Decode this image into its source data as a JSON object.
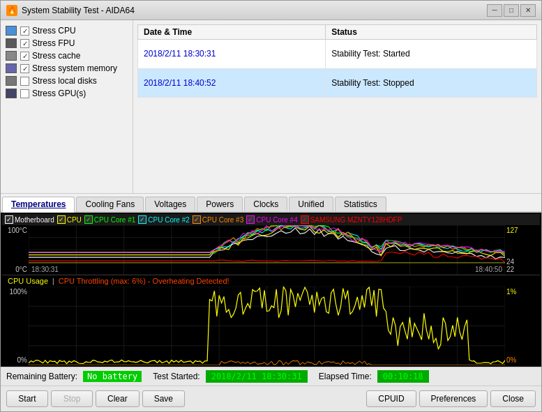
{
  "window": {
    "title": "System Stability Test - AIDA64",
    "icon": "🔥"
  },
  "titlebar": {
    "minimize_label": "─",
    "maximize_label": "□",
    "close_label": "✕"
  },
  "stress_items": [
    {
      "id": "cpu",
      "label": "Stress CPU",
      "checked": true,
      "icon_type": "cpu"
    },
    {
      "id": "fpu",
      "label": "Stress FPU",
      "checked": true,
      "icon_type": "fpu"
    },
    {
      "id": "cache",
      "label": "Stress cache",
      "checked": true,
      "icon_type": "cache"
    },
    {
      "id": "memory",
      "label": "Stress system memory",
      "checked": true,
      "icon_type": "mem"
    },
    {
      "id": "disks",
      "label": "Stress local disks",
      "checked": false,
      "icon_type": "disk"
    },
    {
      "id": "gpu",
      "label": "Stress GPU(s)",
      "checked": false,
      "icon_type": "gpu"
    }
  ],
  "log": {
    "headers": [
      "Date & Time",
      "Status"
    ],
    "rows": [
      {
        "datetime": "2018/2/11 18:30:31",
        "status": "Stability Test: Started",
        "selected": false
      },
      {
        "datetime": "2018/2/11 18:40:52",
        "status": "Stability Test: Stopped",
        "selected": true
      }
    ]
  },
  "tabs": [
    {
      "id": "temperatures",
      "label": "Temperatures",
      "active": true
    },
    {
      "id": "cooling_fans",
      "label": "Cooling Fans",
      "active": false
    },
    {
      "id": "voltages",
      "label": "Voltages",
      "active": false
    },
    {
      "id": "powers",
      "label": "Powers",
      "active": false
    },
    {
      "id": "clocks",
      "label": "Clocks",
      "active": false
    },
    {
      "id": "unified",
      "label": "Unified",
      "active": false
    },
    {
      "id": "statistics",
      "label": "Statistics",
      "active": false
    }
  ],
  "temp_chart": {
    "legend": [
      {
        "label": "Motherboard",
        "color": "#ffffff",
        "checked": true
      },
      {
        "label": "CPU",
        "color": "#ffff00",
        "checked": true
      },
      {
        "label": "CPU Core #1",
        "color": "#00ff00",
        "checked": true
      },
      {
        "label": "CPU Core #2",
        "color": "#00ffff",
        "checked": true
      },
      {
        "label": "CPU Core #3",
        "color": "#ff8800",
        "checked": true
      },
      {
        "label": "CPU Core #4",
        "color": "#ff00ff",
        "checked": true
      },
      {
        "label": "SAMSUNG MZNTY128HDFP",
        "color": "#ff0000",
        "checked": true
      }
    ],
    "y_max": "100°C",
    "y_min": "0°C",
    "right_values": [
      "127",
      "24",
      "22"
    ],
    "x_labels": [
      "18:30:31",
      "18:40:50"
    ],
    "time_start": "18:30:31",
    "time_end": "18:40:50"
  },
  "cpu_chart": {
    "label_usage": "CPU Usage",
    "label_throttling": "CPU Throttling (max: 6%) - Overheating Detected!",
    "y_max": "100%",
    "y_min": "0%",
    "right_values": [
      "1%",
      "0%"
    ]
  },
  "status_bar": {
    "battery_label": "Remaining Battery:",
    "battery_value": "No battery",
    "test_started_label": "Test Started:",
    "test_started_value": "2018/2/11 18:30:31",
    "elapsed_label": "Elapsed Time:",
    "elapsed_value": "00:10:18"
  },
  "buttons": {
    "start": "Start",
    "stop": "Stop",
    "clear": "Clear",
    "save": "Save",
    "cpuid": "CPUID",
    "preferences": "Preferences",
    "close": "Close"
  }
}
